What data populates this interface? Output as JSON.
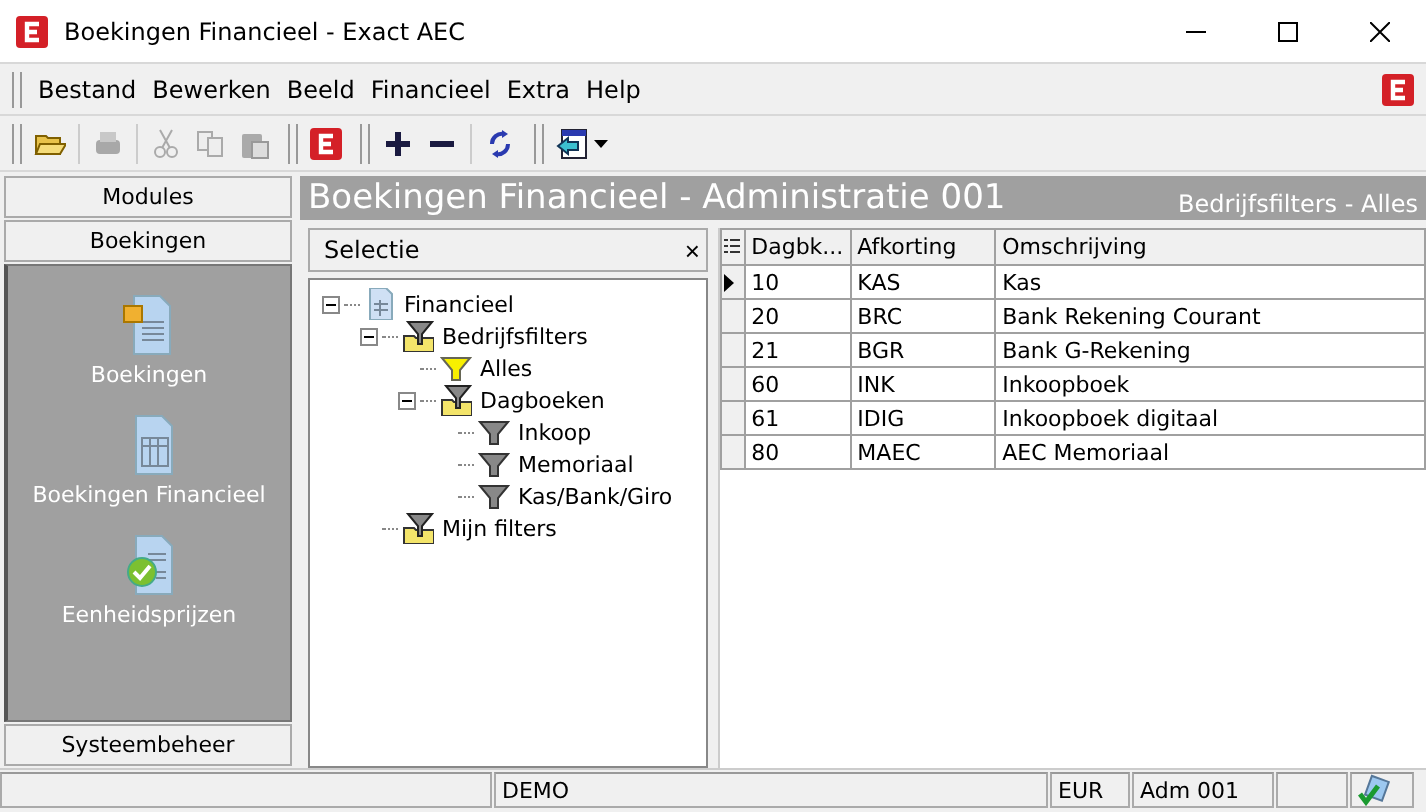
{
  "window": {
    "title": "Boekingen Financieel - Exact AEC"
  },
  "menu": [
    "Bestand",
    "Bewerken",
    "Beeld",
    "Financieel",
    "Extra",
    "Help"
  ],
  "sidebar": {
    "tabs_top": [
      {
        "label": "Modules"
      },
      {
        "label": "Boekingen"
      }
    ],
    "items": [
      {
        "label": "Boekingen",
        "kind": "folder-doc"
      },
      {
        "label": "Boekingen Financieel",
        "kind": "table-doc"
      },
      {
        "label": "Eenheidsprijzen",
        "kind": "check-doc"
      }
    ],
    "tabs_bottom": [
      {
        "label": "Systeembeheer"
      }
    ]
  },
  "header": {
    "title": "Boekingen Financieel - Administratie 001",
    "filter": "Bedrijfsfilters - Alles"
  },
  "selection_panel": {
    "title": "Selectie",
    "close": "×",
    "tree": [
      {
        "label": "Financieel",
        "kind": "root",
        "expanded": true,
        "children": [
          {
            "label": "Bedrijfsfilters",
            "kind": "filter-folder",
            "expanded": true,
            "children": [
              {
                "label": "Alles",
                "kind": "active-filter"
              },
              {
                "label": "Dagboeken",
                "kind": "filter-folder",
                "expanded": true,
                "children": [
                  {
                    "label": "Inkoop",
                    "kind": "filter"
                  },
                  {
                    "label": "Memoriaal",
                    "kind": "filter"
                  },
                  {
                    "label": "Kas/Bank/Giro",
                    "kind": "filter"
                  }
                ]
              }
            ]
          },
          {
            "label": "Mijn filters",
            "kind": "filter-folder"
          }
        ]
      }
    ]
  },
  "table": {
    "columns": [
      "Dagbk...",
      "Afkorting",
      "Omschrijving"
    ],
    "rows": [
      {
        "cells": [
          "10",
          "KAS",
          "Kas"
        ],
        "selected": true
      },
      {
        "cells": [
          "20",
          "BRC",
          "Bank Rekening Courant"
        ],
        "selected": false
      },
      {
        "cells": [
          "21",
          "BGR",
          "Bank G-Rekening"
        ],
        "selected": false
      },
      {
        "cells": [
          "60",
          "INK",
          "Inkoopboek"
        ],
        "selected": false
      },
      {
        "cells": [
          "61",
          "IDIG",
          "Inkoopboek digitaal"
        ],
        "selected": false
      },
      {
        "cells": [
          "80",
          "MAEC",
          "AEC Memoriaal"
        ],
        "selected": false
      }
    ]
  },
  "status_bar": [
    "DEMO",
    "EUR",
    "Adm 001"
  ]
}
